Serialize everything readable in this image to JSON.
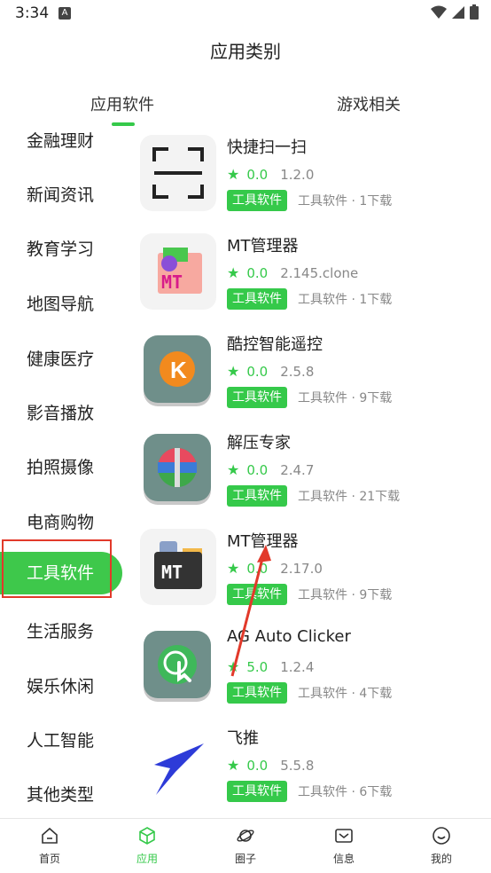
{
  "status": {
    "time": "3:34",
    "notif_glyph": "A"
  },
  "header": {
    "title": "应用类别"
  },
  "tabs": [
    {
      "label": "应用软件",
      "active": true
    },
    {
      "label": "游戏相关",
      "active": false
    }
  ],
  "sidebar": {
    "items": [
      {
        "label": "金融理财"
      },
      {
        "label": "新闻资讯"
      },
      {
        "label": "教育学习"
      },
      {
        "label": "地图导航"
      },
      {
        "label": "健康医疗"
      },
      {
        "label": "影音播放"
      },
      {
        "label": "拍照摄像"
      },
      {
        "label": "电商购物"
      },
      {
        "label": "工具软件",
        "active": true
      },
      {
        "label": "生活服务"
      },
      {
        "label": "娱乐休闲"
      },
      {
        "label": "人工智能"
      },
      {
        "label": "其他类型"
      }
    ]
  },
  "apps": [
    {
      "name": "快捷扫一扫",
      "rating": "0.0",
      "version": "1.2.0",
      "tag": "工具软件",
      "sub": "工具软件 · 1下载",
      "icon": "scan-icon"
    },
    {
      "name": "MT管理器",
      "rating": "0.0",
      "version": "2.145.clone",
      "tag": "工具软件",
      "sub": "工具软件 · 1下载",
      "icon": "mt-manager-clone-icon"
    },
    {
      "name": "酷控智能遥控",
      "rating": "0.0",
      "version": "2.5.8",
      "tag": "工具软件",
      "sub": "工具软件 · 9下载",
      "icon": "remote-control-icon"
    },
    {
      "name": "解压专家",
      "rating": "0.0",
      "version": "2.4.7",
      "tag": "工具软件",
      "sub": "工具软件 · 21下载",
      "icon": "unzip-icon"
    },
    {
      "name": "MT管理器",
      "rating": "0.0",
      "version": "2.17.0",
      "tag": "工具软件",
      "sub": "工具软件 · 9下载",
      "icon": "mt-manager-icon"
    },
    {
      "name": "AG Auto Clicker",
      "rating": "5.0",
      "version": "1.2.4",
      "tag": "工具软件",
      "sub": "工具软件 · 4下载",
      "icon": "auto-clicker-icon"
    },
    {
      "name": "飞推",
      "rating": "0.0",
      "version": "5.5.8",
      "tag": "工具软件",
      "sub": "工具软件 · 6下载",
      "icon": "feitui-icon"
    }
  ],
  "bottom_nav": [
    {
      "label": "首页",
      "icon": "home-icon"
    },
    {
      "label": "应用",
      "icon": "cube-icon",
      "active": true
    },
    {
      "label": "圈子",
      "icon": "planet-icon"
    },
    {
      "label": "信息",
      "icon": "mail-icon"
    },
    {
      "label": "我的",
      "icon": "smile-icon"
    }
  ],
  "colors": {
    "accent": "#35c94a",
    "annotation": "#e2392a"
  }
}
